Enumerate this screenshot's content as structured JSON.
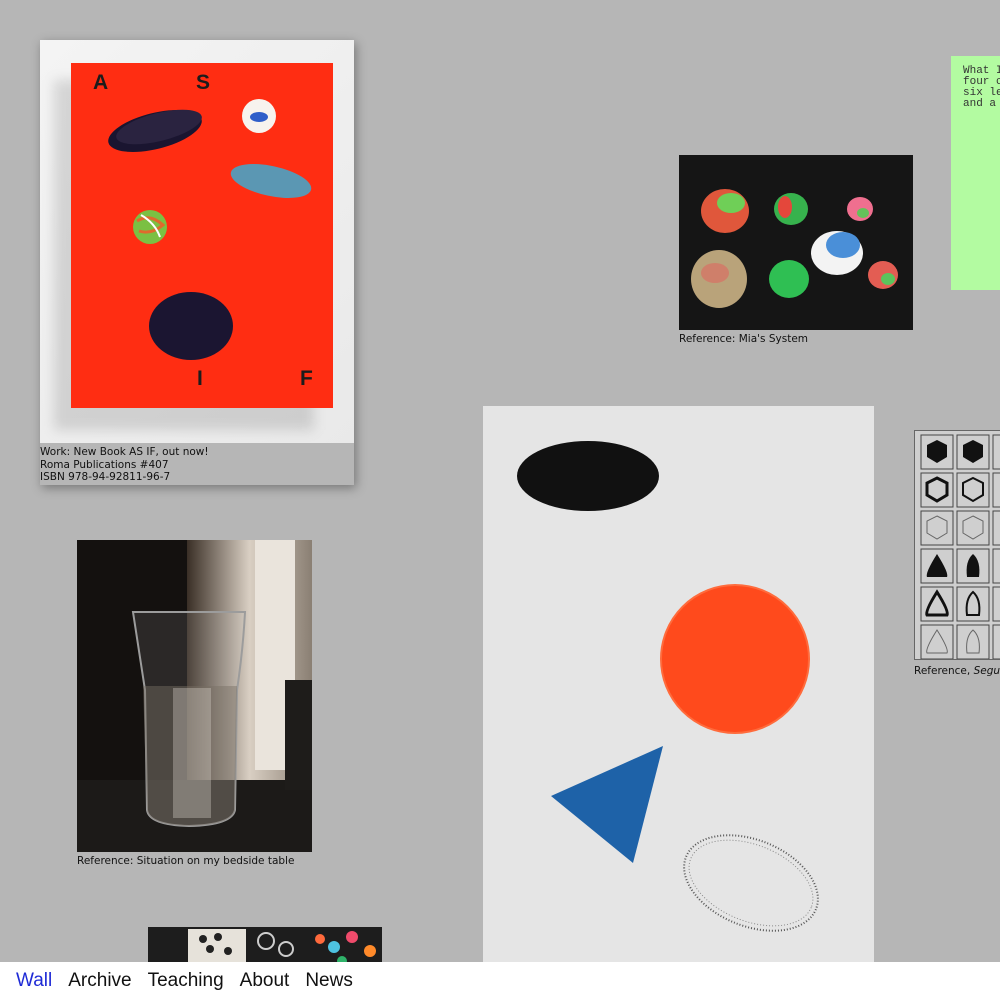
{
  "book": {
    "letters": [
      "A",
      "S",
      "I",
      "F"
    ],
    "caption": "Work: New Book AS IF, out now!\nRoma Publications #407\nISBN 978-94-92811-96-7"
  },
  "clay": {
    "caption": "Reference: Mia's System"
  },
  "note": {
    "text": "What I\nfour c\nsix le\nand a "
  },
  "grid": {
    "caption_prefix": "Reference, ",
    "caption_italic": "Segui"
  },
  "glass": {
    "caption": "Reference: Situation on my bedside table"
  },
  "nav": {
    "items": [
      {
        "label": "Wall",
        "active": true
      },
      {
        "label": "Archive",
        "active": false
      },
      {
        "label": "Teaching",
        "active": false
      },
      {
        "label": "About",
        "active": false
      },
      {
        "label": "News",
        "active": false
      }
    ]
  },
  "colors": {
    "background": "#b6b6b6",
    "cover_red": "#ff2d12",
    "note_green": "#b3fba1",
    "nav_active": "#1f2bd6",
    "print_orange": "#ff4a1c",
    "print_blue": "#1e62a8"
  }
}
